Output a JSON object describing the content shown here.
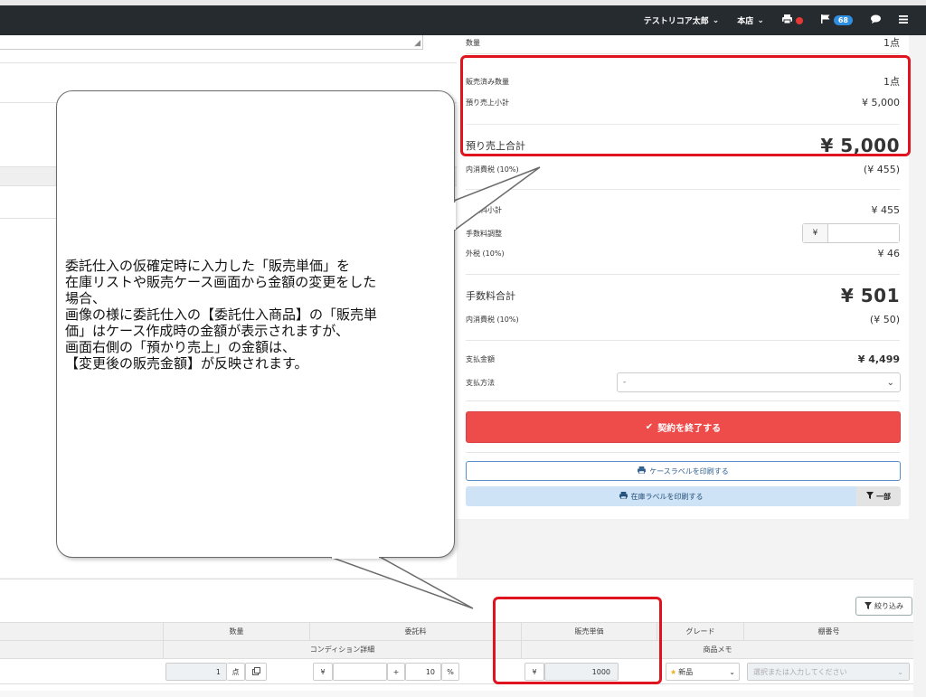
{
  "navbar": {
    "user": "テストリコア太郎",
    "store": "本店",
    "badge_count": "68"
  },
  "summary": {
    "qty_label": "数量",
    "qty_value": "1点",
    "sold_qty_label": "販売済み数量",
    "sold_qty_value": "1点",
    "deposit_subtotal_label": "預り売上小計",
    "deposit_subtotal_value": "¥ 5,000",
    "deposit_total_label": "預り売上合計",
    "deposit_total_value": "¥ 5,000",
    "tax_incl_label_1": "内消費税 (10%)",
    "tax_incl_value_1": "(¥ 455)",
    "fee_subtotal_label": "手数料小計",
    "fee_subtotal_value": "¥ 455",
    "fee_adjust_label": "手数料調整",
    "fee_adjust_prefix": "¥",
    "ext_tax_label": "外税 (10%)",
    "ext_tax_value": "¥ 46",
    "fee_total_label": "手数料合計",
    "fee_total_value": "¥ 501",
    "tax_incl_label_2": "内消費税 (10%)",
    "tax_incl_value_2": "(¥ 50)",
    "payment_amount_label": "支払金額",
    "payment_amount_value": "¥ 4,499",
    "payment_method_label": "支払方法",
    "payment_method_value": "-"
  },
  "buttons": {
    "finish_contract": "契約を終了する",
    "print_case_label": "ケースラベルを印刷する",
    "print_stock_label": "在庫ラベルを印刷する",
    "part": "一部",
    "filter": "絞り込み"
  },
  "table": {
    "headers": [
      "数量",
      "委託料",
      "販売単価",
      "グレード",
      "棚番号"
    ],
    "subheaders": [
      "コンディション詳細",
      "商品メモ"
    ],
    "row": {
      "qty": "1",
      "qty_unit": "点",
      "fee_prefix": "¥",
      "plus": "+",
      "rate": "10",
      "percent": "%",
      "price_prefix": "¥",
      "price": "1000",
      "grade": "新品",
      "shelf_placeholder": "選択または入力してください"
    }
  },
  "callout": {
    "text": "委託仕入の仮確定時に入力した「販売単価」を\n在庫リストや販売ケース画面から金額の変更をした\n場合、\n画像の様に委託仕入の【委託仕入商品】の「販売単\n価」はケース作成時の金額が表示されますが、\n画面右側の「預かり売上」の金額は、\n【変更後の販売金額】が反映されます。"
  },
  "colors": {
    "navbar": "#262b2f",
    "highlight": "#e0141e",
    "finish_button": "#ee4b4b",
    "badge": "#2f8ee0"
  }
}
